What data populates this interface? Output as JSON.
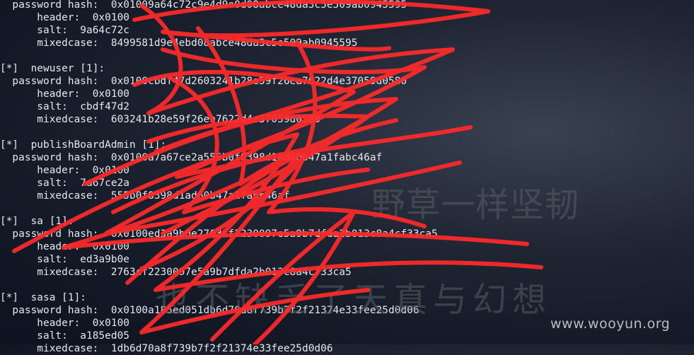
{
  "terminal": {
    "lines": [
      "  password hash:  0x01009a64c72c9e4d9e0d08abce48da3c5e509ab0945595",
      "      header:  0x0100",
      "      salt:  9a64c72c",
      "      mixedcase:  8499581d9e4ebd08abce48da3c5e509ab0945595",
      "",
      "[*]  newuser [1]:",
      "  password hash:  0x0100cbdf47d2603241b28e59f26ea7622d4e37059d0580",
      "      header:  0x0100",
      "      salt:  cbdf47d2",
      "      mixedcase:  603241b28e59f26ea7622d4e37059d0580",
      "",
      "[*]  publishBoardAdmin [1]:",
      "  password hash:  0x0100a7a67ce2a555b0f8398d1ad60b47a1fabc46af",
      "      header:  0x0100",
      "      salt:  7a67ce2a",
      "      mixedcase:  555b0f8398d1ad60b47a1fabc46af",
      "",
      "[*]  sa [1]:",
      "  password hash:  0x0100ed3a9b0e2763cf2230097e5a9b7dfda2b013c8a4cf33ca5",
      "      header:  0x0100",
      "      salt:  ed3a9b0e",
      "      mixedcase:  2763cf2230097e5a9b7dfda2b013c8a4cf33ca5",
      "",
      "[*]  sasa [1]:",
      "  password hash:  0x0100a185ed051db6d70a8f739b7f2f21374e33fee25d0d06",
      "      header:  0x0100",
      "      salt:  a185ed05",
      "      mixedcase:  1db6d70a8f739b7f2f21374e33fee25d0d06"
    ]
  },
  "watermark": {
    "line1": "野草一样坚韧",
    "line2": "也不缺乏了天真与幻想",
    "site": "www.wooyun.org"
  },
  "scribble_color": "#ff2a2a"
}
